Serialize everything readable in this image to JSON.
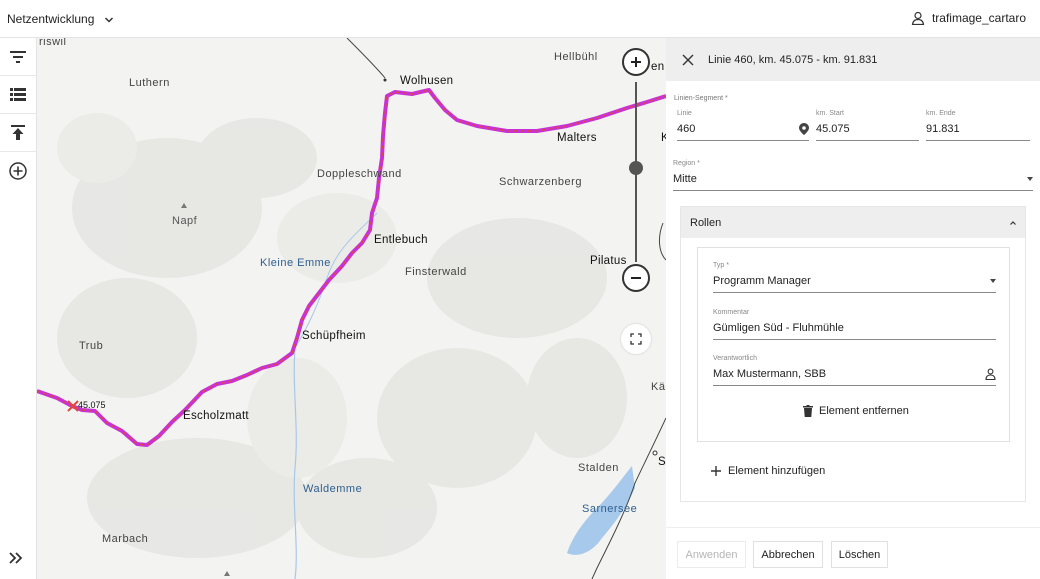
{
  "header": {
    "app_title": "Netzentwicklung",
    "username": "trafimage_cartaro"
  },
  "toolbar": {
    "icons": [
      "filter-icon",
      "list-icon",
      "upload-icon",
      "add-circle-icon"
    ],
    "expand_icon": "double-chevron-right-icon"
  },
  "map": {
    "places": [
      {
        "name": "Hellbühl",
        "kind": "village"
      },
      {
        "name": "Wolhusen",
        "kind": "town"
      },
      {
        "name": "Luthern",
        "kind": "village"
      },
      {
        "name": "Malters",
        "kind": "town"
      },
      {
        "name": "Doppleschwand",
        "kind": "village"
      },
      {
        "name": "Schwarzenberg",
        "kind": "village"
      },
      {
        "name": "Napf",
        "kind": "peak"
      },
      {
        "name": "Entlebuch",
        "kind": "town"
      },
      {
        "name": "Kleine Emme",
        "kind": "water"
      },
      {
        "name": "Finsterwald",
        "kind": "village"
      },
      {
        "name": "Pilatus",
        "kind": "village"
      },
      {
        "name": "Schüpfheim",
        "kind": "town"
      },
      {
        "name": "Trub",
        "kind": "village"
      },
      {
        "name": "Escholzmatt",
        "kind": "town"
      },
      {
        "name": "Stalden",
        "kind": "village"
      },
      {
        "name": "Waldemme",
        "kind": "water"
      },
      {
        "name": "Sarnersee",
        "kind": "water"
      },
      {
        "name": "Marbach",
        "kind": "village"
      },
      {
        "name": "riswil",
        "kind": "village"
      },
      {
        "name": "en",
        "kind": "town"
      },
      {
        "name": "K",
        "kind": "town"
      },
      {
        "name": "Kä",
        "kind": "village"
      },
      {
        "name": "S",
        "kind": "town"
      }
    ],
    "km_marker": "45.075",
    "route_color": "#c732d8",
    "route_dash_color": "#e0473d",
    "zoom_level_fraction": 0.52
  },
  "panel": {
    "title": "Linie 460, km. 45.075 - km. 91.831",
    "segment_label": "Linien-Segment *",
    "linie_label": "Linie",
    "linie_value": "460",
    "km_start_label": "km. Start",
    "km_start_value": "45.075",
    "km_end_label": "km. Ende",
    "km_end_value": "91.831",
    "region_label": "Region *",
    "region_value": "Mitte",
    "roles_title": "Rollen",
    "typ_label": "Typ *",
    "typ_value": "Programm Manager",
    "comment_label": "Kommentar",
    "comment_value": "Gümligen Süd - Fluhmühle",
    "responsible_label": "Verantwortlich",
    "responsible_value": "Max Mustermann, SBB",
    "remove_label": "Element entfernen",
    "add_label": "Element hinzufügen",
    "buttons": {
      "apply": "Anwenden",
      "cancel": "Abbrechen",
      "delete": "Löschen"
    }
  }
}
